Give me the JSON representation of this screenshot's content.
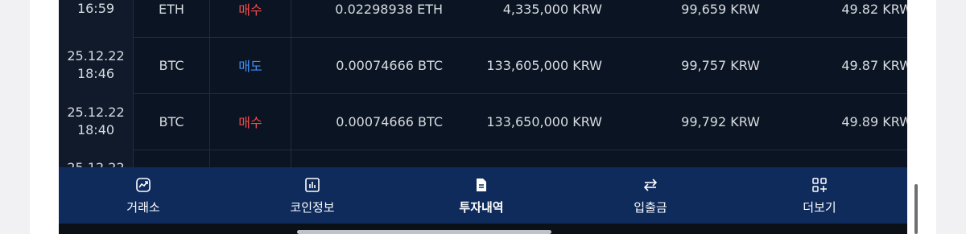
{
  "trades": [
    {
      "date": "",
      "time": "16:59",
      "coin": "ETH",
      "side": "매수",
      "side_type": "buy",
      "qty": "0.02298938 ETH",
      "price": "4,335,000 KRW",
      "amount": "99,659 KRW",
      "fee": "49.82 KRW"
    },
    {
      "date": "25.12.22",
      "time": "18:46",
      "coin": "BTC",
      "side": "매도",
      "side_type": "sell",
      "qty": "0.00074666 BTC",
      "price": "133,605,000 KRW",
      "amount": "99,757 KRW",
      "fee": "49.87 KRW"
    },
    {
      "date": "25.12.22",
      "time": "18:40",
      "coin": "BTC",
      "side": "매수",
      "side_type": "buy",
      "qty": "0.00074666 BTC",
      "price": "133,650,000 KRW",
      "amount": "99,792 KRW",
      "fee": "49.89 KRW"
    },
    {
      "date": "25.12.22",
      "time": "",
      "coin": "",
      "side": "",
      "side_type": "buy",
      "qty": "",
      "price": "",
      "amount": "",
      "fee": ""
    }
  ],
  "nav": {
    "items": [
      {
        "label": "거래소",
        "icon": "chart-icon"
      },
      {
        "label": "코인정보",
        "icon": "bar-chart-icon"
      },
      {
        "label": "투자내역",
        "icon": "document-icon",
        "active": true
      },
      {
        "label": "입출금",
        "icon": "transfer-icon"
      },
      {
        "label": "더보기",
        "icon": "more-grid-icon"
      }
    ]
  },
  "colors": {
    "buy": "#f24a4a",
    "sell": "#3e8ef6",
    "nav_bg": "#0e2b5c",
    "table_bg": "#0b1422"
  }
}
